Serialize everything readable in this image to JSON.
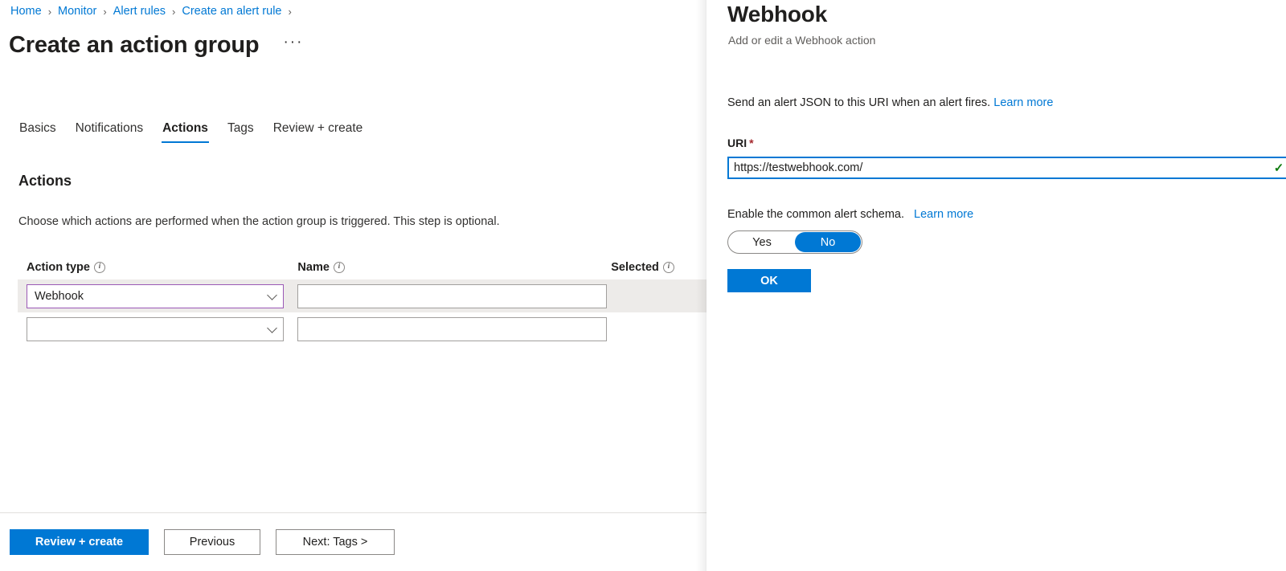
{
  "breadcrumb": {
    "items": [
      "Home",
      "Monitor",
      "Alert rules",
      "Create an alert rule"
    ],
    "separator": "›"
  },
  "header": {
    "title": "Create an action group",
    "more_menu": "···"
  },
  "tabs": [
    {
      "label": "Basics",
      "active": false
    },
    {
      "label": "Notifications",
      "active": false
    },
    {
      "label": "Actions",
      "active": true
    },
    {
      "label": "Tags",
      "active": false
    },
    {
      "label": "Review + create",
      "active": false
    }
  ],
  "section": {
    "heading": "Actions",
    "description": "Choose which actions are performed when the action group is triggered. This step is optional."
  },
  "table": {
    "columns": [
      {
        "label": "Action type",
        "info": "info-icon"
      },
      {
        "label": "Name",
        "info": "info-icon"
      },
      {
        "label": "Selected",
        "info": "info-icon"
      }
    ],
    "rows": [
      {
        "action_type": "Webhook",
        "action_type_placeholder": "",
        "name": "",
        "name_placeholder": "",
        "selected": "",
        "highlighted": true
      },
      {
        "action_type": "",
        "action_type_placeholder": "",
        "name": "",
        "name_placeholder": "",
        "selected": "",
        "highlighted": false
      }
    ]
  },
  "footer": {
    "review_create": "Review + create",
    "previous": "Previous",
    "next": "Next: Tags >"
  },
  "flyout": {
    "title": "Webhook",
    "subtitle": "Add or edit a Webhook action",
    "intro_text": "Send an alert JSON to this URI when an alert fires.",
    "intro_link": "Learn more",
    "uri_label": "URI",
    "uri_required_marker": "*",
    "uri_value": "https://testwebhook.com/",
    "uri_placeholder": "",
    "uri_valid_icon": "checkmark-icon",
    "uri_valid_glyph": "✓",
    "schema_text": "Enable the common alert schema.",
    "schema_link": "Learn more",
    "toggle": {
      "yes_label": "Yes",
      "no_label": "No",
      "selected": "No"
    },
    "ok_label": "OK"
  },
  "colors": {
    "accent": "#0078d4",
    "link": "#0078d4",
    "required": "#a4262c",
    "valid": "#107c10",
    "visited_border": "#9b59b6",
    "row_highlight": "#edebe9",
    "border": "#a19f9d"
  }
}
